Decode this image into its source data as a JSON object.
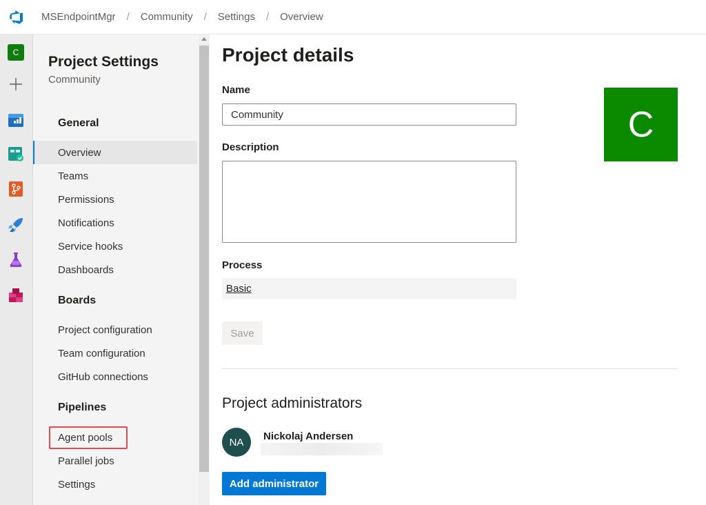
{
  "breadcrumb": [
    "MSEndpointMgr",
    "Community",
    "Settings",
    "Overview"
  ],
  "rail": {
    "org_initial": "C",
    "items": [
      "boards-icon",
      "test-plans-icon",
      "repos-icon",
      "pipelines-icon",
      "test-icon",
      "artifacts-icon"
    ]
  },
  "nav": {
    "title": "Project Settings",
    "subtitle": "Community",
    "general": {
      "header": "General",
      "items": [
        "Overview",
        "Teams",
        "Permissions",
        "Notifications",
        "Service hooks",
        "Dashboards"
      ]
    },
    "boards": {
      "header": "Boards",
      "items": [
        "Project configuration",
        "Team configuration",
        "GitHub connections"
      ]
    },
    "pipelines": {
      "header": "Pipelines",
      "items": [
        "Agent pools",
        "Parallel jobs",
        "Settings"
      ]
    },
    "active": "Overview",
    "highlighted": "Agent pools"
  },
  "main": {
    "title": "Project details",
    "name_label": "Name",
    "name_value": "Community",
    "description_label": "Description",
    "description_value": "",
    "process_label": "Process",
    "process_value": "Basic",
    "save_label": "Save",
    "project_initial": "C",
    "admins_title": "Project administrators",
    "admin": {
      "initials": "NA",
      "name": "Nickolaj Andersen"
    },
    "add_admin_label": "Add administrator"
  },
  "colors": {
    "accent": "#0078d4",
    "project_tile": "#0b8a00",
    "highlight": "#e04a4a"
  }
}
